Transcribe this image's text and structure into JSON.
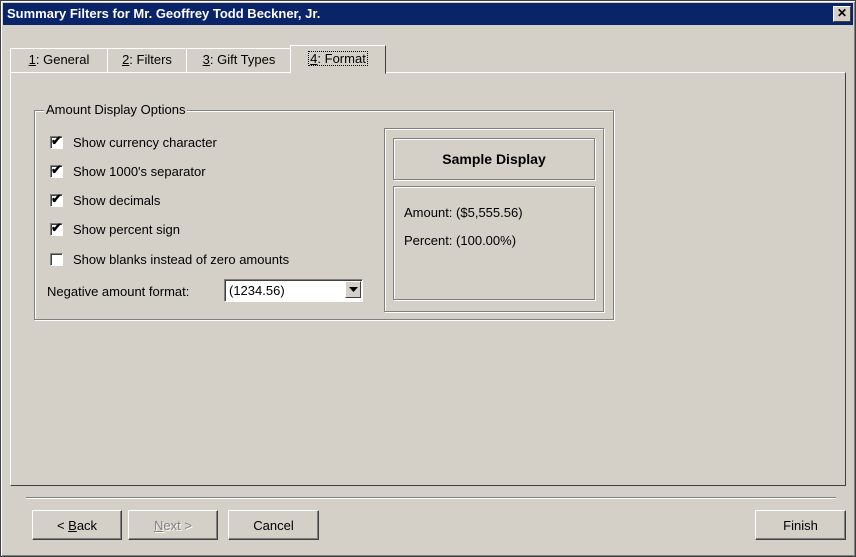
{
  "window": {
    "title": "Summary Filters for Mr. Geoffrey Todd Beckner, Jr.",
    "close_glyph": "✕"
  },
  "tabs": [
    {
      "key": "1",
      "label": ": General",
      "active": false
    },
    {
      "key": "2",
      "label": ": Filters",
      "active": false
    },
    {
      "key": "3",
      "label": ": Gift Types",
      "active": false
    },
    {
      "key": "4",
      "label": ": Format",
      "active": true
    }
  ],
  "amount_display": {
    "group_label": "Amount Display Options",
    "options": [
      {
        "label": "Show currency character",
        "checked": true
      },
      {
        "label": "Show 1000's separator",
        "checked": true
      },
      {
        "label": "Show decimals",
        "checked": true
      },
      {
        "label": "Show percent sign",
        "checked": true
      },
      {
        "label": "Show blanks instead of zero amounts",
        "checked": false
      }
    ],
    "negative_format_label": "Negative amount format:",
    "negative_format_value": "(1234.56)",
    "check_glyph": "✔"
  },
  "sample": {
    "title": "Sample Display",
    "amount_label": "Amount:",
    "amount_value": "($5,555.56)",
    "percent_label": "Percent:",
    "percent_value": "(100.00%)"
  },
  "buttons": {
    "back_prefix": "< ",
    "back_key": "B",
    "back_rest": "ack",
    "next_key": "N",
    "next_rest": "ext >",
    "cancel": "Cancel",
    "finish": "Finish"
  },
  "icons": {
    "close": "close-icon",
    "dropdown": "chevron-down-icon",
    "check": "checkmark-icon"
  }
}
